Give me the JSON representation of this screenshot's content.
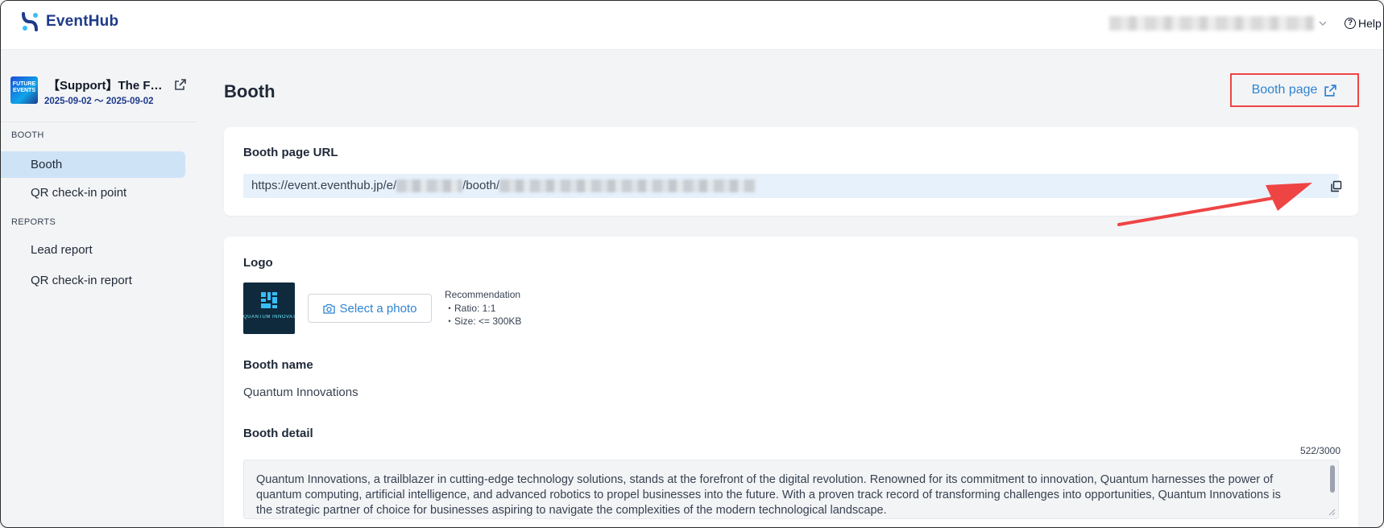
{
  "app": {
    "name": "EventHub"
  },
  "header": {
    "help_label": "Help"
  },
  "sidebar": {
    "event": {
      "title": "【Support】The F…",
      "dates": "2025-09-02 〜 2025-09-02",
      "thumb_text": "FUTURE EVENTS"
    },
    "sections": [
      {
        "label": "BOOTH",
        "items": [
          {
            "label": "Booth",
            "active": true
          },
          {
            "label": "QR check-in point",
            "active": false
          }
        ]
      },
      {
        "label": "REPORTS",
        "items": [
          {
            "label": "Lead report",
            "active": false
          },
          {
            "label": "QR check-in report",
            "active": false
          }
        ]
      }
    ]
  },
  "main": {
    "title": "Booth",
    "booth_page_button": "Booth page",
    "url_card": {
      "label": "Booth page URL",
      "url_prefix": "https://event.eventhub.jp/e/",
      "url_middle": "/booth/"
    },
    "logo_section": {
      "label": "Logo",
      "logo_caption": "QUANTUM INNOVATIONS",
      "select_photo": "Select a photo",
      "recommendation_title": "Recommendation",
      "ratio": "・Ratio: 1:1",
      "size": "・Size: <= 300KB"
    },
    "booth_name": {
      "label": "Booth name",
      "value": "Quantum Innovations"
    },
    "booth_detail": {
      "label": "Booth detail",
      "counter": "522/3000",
      "text": "Quantum Innovations, a trailblazer in cutting-edge technology solutions, stands at the forefront of the digital revolution. Renowned for its commitment to innovation, Quantum harnesses the power of quantum computing, artificial intelligence, and advanced robotics to propel businesses into the future. With a proven track record of transforming challenges into opportunities, Quantum Innovations is the strategic partner of choice for businesses aspiring to navigate the complexities of the modern technological landscape."
    }
  },
  "colors": {
    "accent_blue": "#2f84d0",
    "brand_navy": "#1e3a8a",
    "highlight_red": "#ef4444",
    "active_nav": "#cfe3f7"
  },
  "icons": [
    "eventhub-logo-icon",
    "chevron-down-icon",
    "help-icon",
    "external-link-icon",
    "copy-icon",
    "camera-icon"
  ]
}
